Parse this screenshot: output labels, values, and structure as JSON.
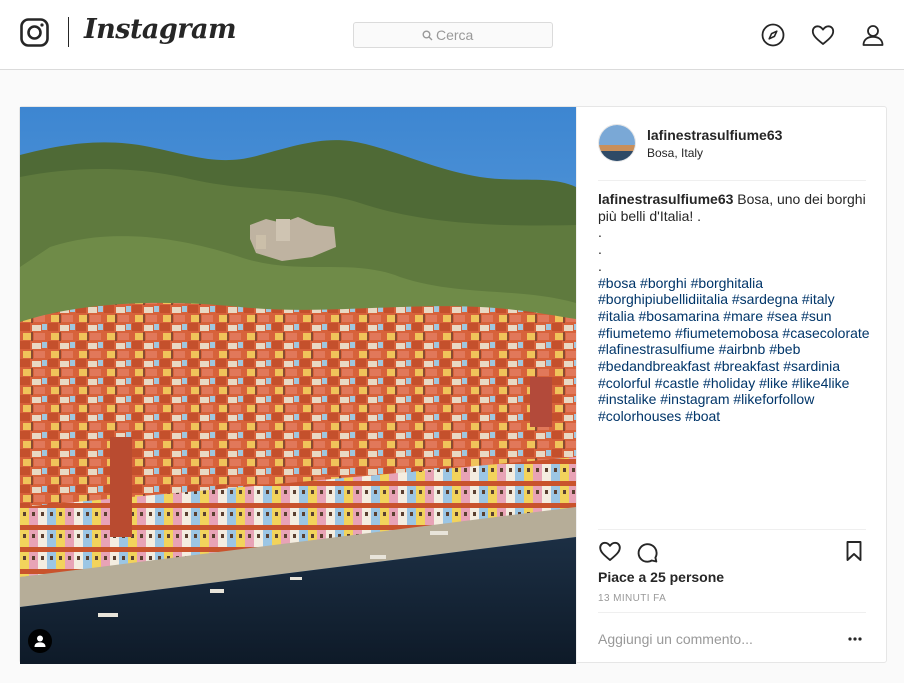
{
  "app": {
    "wordmark": "Instagram"
  },
  "search": {
    "placeholder": "Cerca"
  },
  "nav": {
    "icons": [
      "compass-icon",
      "heart-icon",
      "profile-icon"
    ]
  },
  "post": {
    "username": "lafinestrasulfiume63",
    "location": "Bosa, Italy",
    "caption": {
      "username": "lafinestrasulfiume63",
      "text": " Bosa, uno dei borghi più belli d'Italia! .",
      "dots": ".\n.\n.",
      "hashtags": "#bosa #borghi #borghitalia #borghipiubellidiitalia #sardegna #italy #italia #bosamarina #mare #sea #sun #fiumetemo #fiumetemobosa #casecolorate #lafinestrasulfiume #airbnb #beb #bedandbreakfast #breakfast #sardinia #colorful #castle #holiday #like #like4like #instalike #instagram #likeforfollow #colorhouses #boat"
    },
    "likes_text": "Piace a 25 persone",
    "timestamp": "13 minuti fa",
    "comment_placeholder": "Aggiungi un commento...",
    "photo_icons": [
      "user-tag-icon"
    ]
  },
  "colors": {
    "text": "#262626",
    "hashtag": "#003569",
    "muted": "#999999",
    "border": "#dbdbdb",
    "background": "#fafafa"
  }
}
